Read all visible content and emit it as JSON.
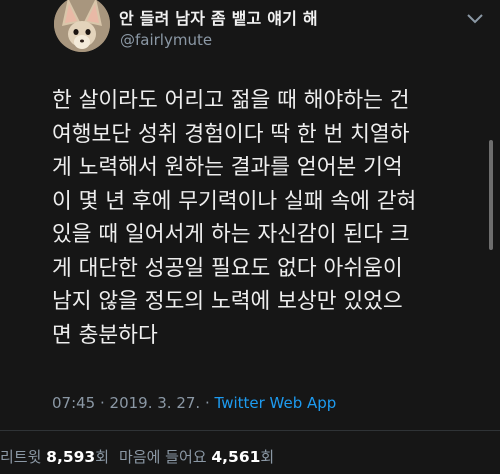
{
  "user": {
    "display_name": "안 들려 남자 좀 뱉고 얘기 해",
    "handle": "@fairlymute"
  },
  "tweet": {
    "lines": [
      "한 살이라도 어리고 젊을 때 해야하는 건",
      "여행보단 성취 경험이다 딱 한 번 치열하",
      "게 노력해서 원하는 결과를 얻어본 기억",
      "이 몇 년 후에 무기력이나 실패 속에 갇혀",
      "있을 때 일어서게 하는 자신감이 된다 크",
      "게 대단한 성공일 필요도 없다 아쉬움이",
      "남지 않을 정도의 노력에 보상만 있었으",
      "면 충분하다"
    ]
  },
  "meta": {
    "time": "07:45",
    "dot1": " · ",
    "date": "2019. 3. 27.",
    "dot2": " · ",
    "app": "Twitter Web App"
  },
  "stats": {
    "retweet_label": "리트윗 ",
    "retweet_count": "8,593",
    "retweet_unit": "회",
    "like_label": "마음에 들어요 ",
    "like_count": "4,561",
    "like_unit": "회"
  },
  "icons": {
    "avatar": "fennec-fox-avatar",
    "menu": "chevron-down-icon"
  },
  "colors": {
    "background": "#161616",
    "link": "#1d9bf0",
    "muted": "#8b98a5"
  }
}
